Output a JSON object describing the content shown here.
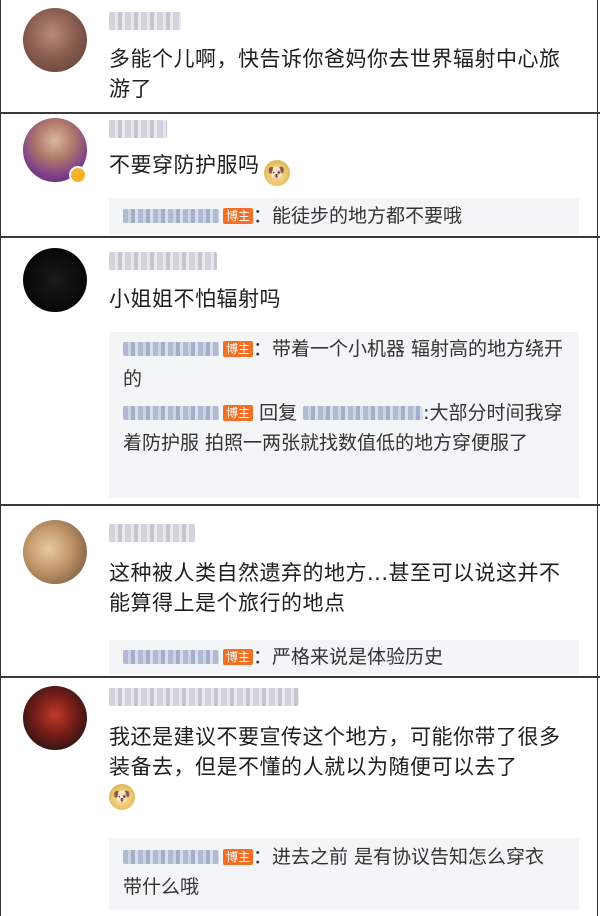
{
  "comments": [
    {
      "username": "Ezereal_...",
      "text": "多能个儿啊，快告诉你爸妈你去世界辐射中心旅游了",
      "replies": []
    },
    {
      "username": "冷福凝",
      "text": "不要穿防护服吗",
      "emoji": "doge-emoji",
      "replies": [
        {
          "author": "Lorelei01",
          "tag": "博主",
          "text": "：能徒步的地方都不要哦"
        }
      ]
    },
    {
      "username": "Lemqq_0123",
      "text": "小姐姐不怕辐射吗",
      "replies": [
        {
          "author": "Lorelei01",
          "tag": "博主",
          "text": "：带着一个小机器 辐射高的地方绕开的"
        },
        {
          "author": "Lorelei01",
          "tag": "博主",
          "reply_prefix": "回复",
          "mention": "@Cyzhou_",
          "text": ":大部分时间我穿着防护服 拍照一两张就找数值低的地方穿便服了"
        }
      ]
    },
    {
      "username": "吴越不吃饭",
      "text": "这种被人类自然遗弃的地方...甚至可以说这并不能算得上是个旅行的地点",
      "replies": [
        {
          "author": "Lorelei01",
          "tag": "博主",
          "text": "：严格来说是体验历史"
        }
      ]
    },
    {
      "username": "没有最圆一dg英语",
      "text": "我还是建议不要宣传这个地方，可能你带了很多装备去，但是不懂的人就以为随便可以去了",
      "emoji": "doge-emoji",
      "replies": [
        {
          "author": "Lorelei01",
          "tag": "博主",
          "text": "：进去之前 是有协议告知怎么穿衣 带什么哦"
        }
      ]
    }
  ],
  "emoji_glyph": "🐶",
  "colors": {
    "tag_bg": "#f26f25",
    "reply_bg": "#f4f5f7",
    "divider": "#3a3a3a"
  }
}
